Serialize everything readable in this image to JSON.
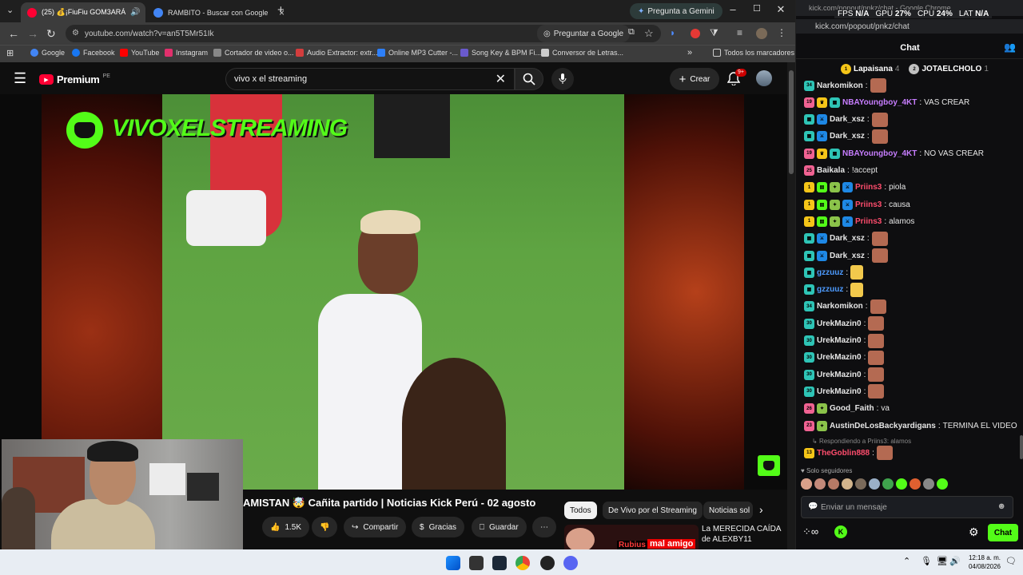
{
  "perf": {
    "fps_label": "FPS",
    "fps": "N/A",
    "gpu_label": "GPU",
    "gpu": "27%",
    "cpu_label": "CPU",
    "cpu": "24%",
    "lat_label": "LAT",
    "lat": "N/A"
  },
  "tabs": [
    {
      "title": "(25) 💰¡FiuFiu GOM3ARÁ",
      "active": true,
      "color": "#ff0033"
    },
    {
      "title": "RAMBITO - Buscar con Google",
      "active": false,
      "color": "#4285f4"
    }
  ],
  "gemini_button": "Pregunta a Gemini",
  "address": {
    "url": "youtube.com/watch?v=an5T5Mr51Ik",
    "ask": "Preguntar a Google"
  },
  "bookmarks": [
    {
      "label": "Google",
      "color": "#4285f4"
    },
    {
      "label": "Facebook",
      "color": "#1877f2"
    },
    {
      "label": "YouTube",
      "color": "#ff0000"
    },
    {
      "label": "Instagram",
      "color": "#e1306c"
    },
    {
      "label": "Cortador de video o...",
      "color": "#888888"
    },
    {
      "label": "Audio Extractor: extr...",
      "color": "#d33d3d"
    },
    {
      "label": "Online MP3 Cutter -...",
      "color": "#2d7ff9"
    },
    {
      "label": "Song Key & BPM Fi...",
      "color": "#6a5acd"
    },
    {
      "label": "Conversor de Letras...",
      "color": "#cccccc"
    }
  ],
  "all_bookmarks": "Todos los marcadores",
  "yt": {
    "logo": "Premium",
    "region": "PE",
    "search": "vivo x el streaming",
    "create": "Crear",
    "notif": "9+"
  },
  "video": {
    "overlay": "VIVOXELSTREAMING"
  },
  "meta": {
    "title": "AMISTAN 🤯 Cañita partido | Noticias Kick Perú - 02 agosto",
    "likes": "1.5K",
    "share": "Compartir",
    "thanks": "Gracias",
    "save": "Guardar",
    "chips": [
      "Todos",
      "De Vivo por el Streaming",
      "Noticias sol"
    ],
    "rec_title": "La MERECIDA CAÍDA de ALEXBY11",
    "rec_thumb_text": "mal amigo",
    "rec_thumb_name": "Rubius"
  },
  "popout": {
    "title": "kick.com/popout/pnkz/chat - Google Chrome",
    "url": "kick.com/popout/pnkz/chat",
    "header": "Chat"
  },
  "top_gifters": [
    {
      "rank": "1",
      "name": "Lapaisana",
      "count": "4",
      "color": "#f5c518"
    },
    {
      "rank": "2",
      "name": "JOTAELCHOLO",
      "count": "1",
      "color": "#c0c0c0"
    }
  ],
  "chat_messages": [
    {
      "user": "Narkomikon",
      "color": "#e6e6e6",
      "text": "",
      "emote": true,
      "badges": [
        "34"
      ]
    },
    {
      "user": "NBAYoungboy_4KT",
      "color": "#c77dff",
      "text": "VAS CREAR",
      "emote": false,
      "badges": [
        "19",
        "crown",
        "gift"
      ]
    },
    {
      "user": "Dark_xsz",
      "color": "#e6e6e6",
      "text": "",
      "emote": true,
      "badges": [
        "gift",
        "sword"
      ]
    },
    {
      "user": "Dark_xsz",
      "color": "#e6e6e6",
      "text": "",
      "emote": true,
      "badges": [
        "gift",
        "sword"
      ]
    },
    {
      "user": "NBAYoungboy_4KT",
      "color": "#c77dff",
      "text": "NO VAS CREAR",
      "emote": false,
      "badges": [
        "19",
        "crown",
        "gift"
      ]
    },
    {
      "user": "Baikala",
      "color": "#e6e6e6",
      "text": "!accept",
      "emote": false,
      "badges": [
        "25"
      ]
    },
    {
      "user": "Priins3",
      "color": "#ff4d6d",
      "text": "piola",
      "emote": false,
      "badges": [
        "1",
        "box",
        "leaf",
        "sword"
      ]
    },
    {
      "user": "Priins3",
      "color": "#ff4d6d",
      "text": "causa",
      "emote": false,
      "badges": [
        "1",
        "box",
        "leaf",
        "sword"
      ]
    },
    {
      "user": "Priins3",
      "color": "#ff4d6d",
      "text": "alamos",
      "emote": false,
      "badges": [
        "1",
        "box",
        "leaf",
        "sword"
      ]
    },
    {
      "user": "Dark_xsz",
      "color": "#e6e6e6",
      "text": "",
      "emote": true,
      "badges": [
        "gift",
        "sword"
      ]
    },
    {
      "user": "Dark_xsz",
      "color": "#e6e6e6",
      "text": "",
      "emote": true,
      "badges": [
        "gift",
        "sword"
      ]
    },
    {
      "user": "gzzuuz",
      "color": "#4d9bff",
      "text": "",
      "emote": true,
      "badges": [
        "gift"
      ]
    },
    {
      "user": "gzzuuz",
      "color": "#4d9bff",
      "text": "",
      "emote": true,
      "badges": [
        "gift"
      ]
    },
    {
      "user": "Narkomikon",
      "color": "#e6e6e6",
      "text": "",
      "emote": true,
      "badges": [
        "34"
      ]
    },
    {
      "user": "UrekMazin0",
      "color": "#e6e6e6",
      "text": "",
      "emote": true,
      "badges": [
        "30"
      ]
    },
    {
      "user": "UrekMazin0",
      "color": "#e6e6e6",
      "text": "",
      "emote": true,
      "badges": [
        "30"
      ]
    },
    {
      "user": "UrekMazin0",
      "color": "#e6e6e6",
      "text": "",
      "emote": true,
      "badges": [
        "30"
      ]
    },
    {
      "user": "UrekMazin0",
      "color": "#e6e6e6",
      "text": "",
      "emote": true,
      "badges": [
        "30"
      ]
    },
    {
      "user": "UrekMazin0",
      "color": "#e6e6e6",
      "text": "",
      "emote": true,
      "badges": [
        "30"
      ]
    },
    {
      "user": "Good_Faith",
      "color": "#e6e6e6",
      "text": "va",
      "emote": false,
      "badges": [
        "26",
        "leaf"
      ]
    },
    {
      "user": "AustinDeLosBackyardigans",
      "color": "#e6e6e6",
      "text": "TERMINA EL VIDEO",
      "emote": false,
      "badges": [
        "23",
        "leaf"
      ]
    }
  ],
  "reply": {
    "note": "Respondiendo a Priins3: alamos",
    "user": "TheGoblin888",
    "color": "#ff4d6d",
    "badge": "13"
  },
  "followers_only": "Solo seguidores",
  "chat_input_placeholder": "Enviar un mensaje",
  "chat_button": "Chat",
  "clock": {
    "time": "12:18 a. m.",
    "date": "04/08/2026"
  },
  "colors": {
    "kick_green": "#53fc18",
    "yt_red": "#ff0033"
  }
}
